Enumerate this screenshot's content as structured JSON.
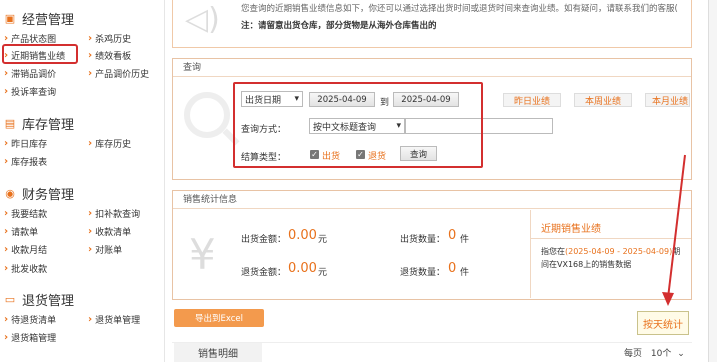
{
  "sidebar": {
    "sections": [
      {
        "title": "经营管理",
        "icon": "briefcase-icon"
      },
      {
        "title": "库存管理",
        "icon": "warehouse-icon"
      },
      {
        "title": "财务管理",
        "icon": "coin-icon"
      },
      {
        "title": "退货管理",
        "icon": "return-icon"
      }
    ],
    "items": {
      "a1": "产品状态图",
      "a2": "杀鸡历史",
      "a3": "近期销售业绩",
      "a4": "绩效看板",
      "a5": "滞销品调价",
      "a6": "产品调价历史",
      "a7": "投诉率查询",
      "b1": "昨日库存",
      "b2": "库存历史",
      "b3": "库存报表",
      "c1": "我要结款",
      "c2": "扣补款查询",
      "c3": "请款单",
      "c4": "收款清单",
      "c5": "收款月结",
      "c6": "对账单",
      "c7": "批发收款",
      "d1": "待退货清单",
      "d2": "退货单管理",
      "d3": "退货箱管理"
    }
  },
  "notice": {
    "line1": "您查询的近期销售业绩信息如下，你还可以通过选择出货时间或退货时间来查询业绩。如有疑问，请联系我们的客服(",
    "line2": "注：请留意出货仓库，部分货物是从海外仓库售出的"
  },
  "query": {
    "header": "查询",
    "date_type": "出货日期",
    "date_from": "2025-04-09",
    "to_label": "到",
    "date_to": "2025-04-09",
    "quick": [
      "昨日业绩",
      "本周业绩",
      "本月业绩"
    ],
    "method_label": "查询方式：",
    "method_value": "按中文标题查询",
    "method_input": "",
    "settle_label": "结算类型：",
    "chk_ship": "出货",
    "chk_return": "退货",
    "query_btn": "查询"
  },
  "stats": {
    "header": "销售统计信息",
    "ship_amount_label": "出货金额：",
    "ship_amount": "0.00",
    "ship_amount_unit": "元",
    "ship_qty_label": "出货数量：",
    "ship_qty": "0",
    "ship_qty_unit": "件",
    "ret_amount_label": "退货金额：",
    "ret_amount": "0.00",
    "ret_amount_unit": "元",
    "ret_qty_label": "退货数量：",
    "ret_qty": "0",
    "ret_qty_unit": "件",
    "panel_title": "近期销售业绩",
    "panel_pre": "指您在",
    "panel_range": "(2025-04-09 - 2025-04-09)",
    "panel_post": "期间在VX168上的销售数据"
  },
  "actions": {
    "export": "导出到Excel",
    "today": "按天统计"
  },
  "bottom": {
    "tab": "销售明细",
    "per_page_label": "每页",
    "per_page_value": "10个"
  },
  "colors": {
    "accent": "#e8711c",
    "highlight": "#d32f2f"
  }
}
